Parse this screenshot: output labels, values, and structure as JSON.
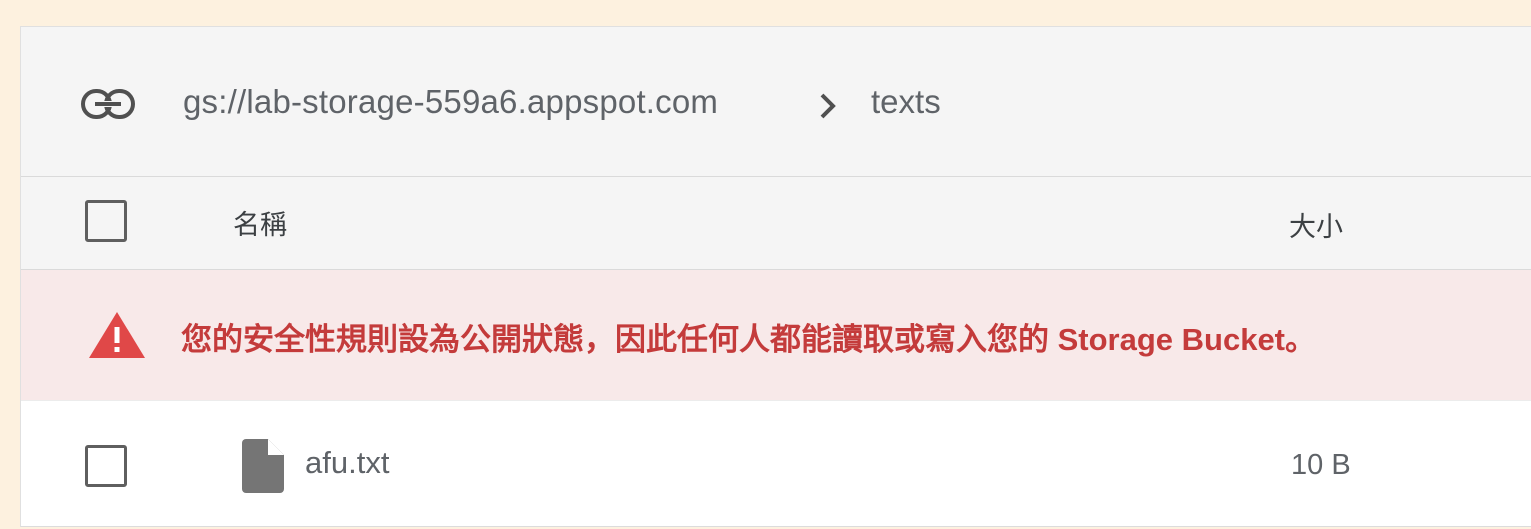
{
  "breadcrumb": {
    "bucket": "gs://lab-storage-559a6.appspot.com",
    "folder": "texts",
    "link_icon": "link-icon",
    "separator_icon": "chevron-right-icon"
  },
  "table": {
    "headers": {
      "name": "名稱",
      "size": "大小"
    },
    "rows": [
      {
        "icon": "file-icon",
        "name": "afu.txt",
        "size": "10 B"
      }
    ]
  },
  "warning": {
    "icon": "warning-icon",
    "message": "您的安全性規則設為公開狀態，因此任何人都能讀取或寫入您的 Storage Bucket。"
  },
  "colors": {
    "page_background": "#fdf1df",
    "toolbar_background": "#f5f5f5",
    "warning_background": "#f8e9e9",
    "warning_text": "#c43b3b",
    "warning_icon": "#e04848",
    "secondary_text": "#5f6368"
  }
}
